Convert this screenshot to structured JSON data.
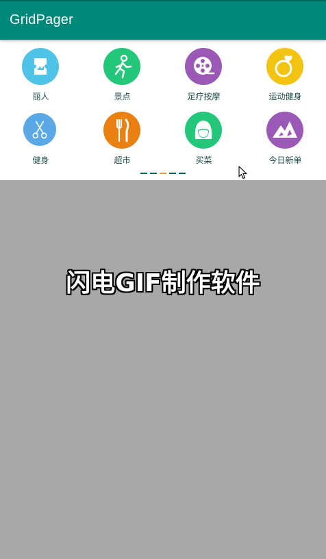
{
  "app": {
    "title": "GridPager"
  },
  "grid": {
    "items": [
      {
        "label": "丽人",
        "icon": "ticket-icon",
        "color": "#4fc3e8"
      },
      {
        "label": "景点",
        "icon": "runner-icon",
        "color": "#22c77a"
      },
      {
        "label": "足疗按摩",
        "icon": "film-reel-icon",
        "color": "#9b59b6"
      },
      {
        "label": "运动健身",
        "icon": "ring-heart-icon",
        "color": "#f2c311"
      },
      {
        "label": "健身",
        "icon": "scissors-icon",
        "color": "#5aa9e6"
      },
      {
        "label": "超市",
        "icon": "fork-knife-icon",
        "color": "#ea7f12"
      },
      {
        "label": "买菜",
        "icon": "girl-face-icon",
        "color": "#22c77a"
      },
      {
        "label": "今日新单",
        "icon": "mountain-icon",
        "color": "#9b59b6"
      }
    ]
  },
  "pager": {
    "page_count": 5,
    "active_index": 2,
    "dot_color": "#00695c",
    "active_color": "#e0a040"
  },
  "watermark": {
    "text": "闪电GIF制作软件"
  },
  "colors": {
    "appbar": "#00897b",
    "status_strip": "#00695c",
    "content_background": "#a8a8a8",
    "panel_background": "#ffffff",
    "label_text": "#1f4e4b"
  }
}
